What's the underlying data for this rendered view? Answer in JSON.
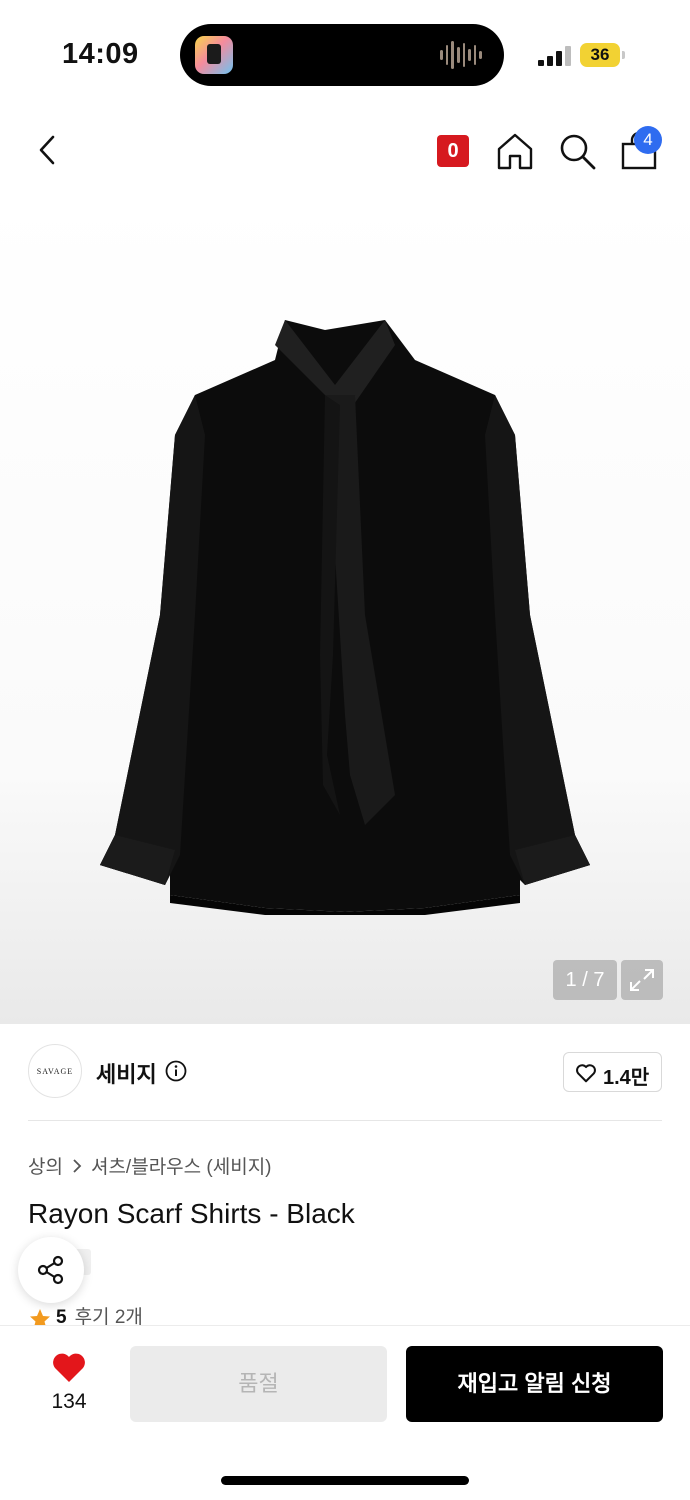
{
  "status_bar": {
    "time": "14:09",
    "battery": "36"
  },
  "nav": {
    "coupon_badge": "0",
    "cart_count": "4",
    "colors": {
      "badge_red": "#d6191f",
      "badge_blue": "#2f6cf0"
    }
  },
  "gallery": {
    "counter": "1 / 7"
  },
  "brand": {
    "logo_text": "SAVAGE",
    "name": "세비지",
    "likes": "1.4만"
  },
  "breadcrumb": {
    "category": "상의",
    "subcategory": "셔츠/블라우스 (세비지)"
  },
  "product": {
    "title": "Rayon Scarf Shirts - Black",
    "rating": "5",
    "reviews": "후기 2개"
  },
  "bottom": {
    "wish_count": "134",
    "soldout_label": "품절",
    "restock_label": "재입고 알림 신청"
  },
  "icons": [
    "back-icon",
    "home-icon",
    "search-icon",
    "cart-icon",
    "expand-icon",
    "info-icon",
    "heart-outline-icon",
    "chevron-right-icon",
    "share-icon",
    "star-icon",
    "heart-filled-icon"
  ]
}
